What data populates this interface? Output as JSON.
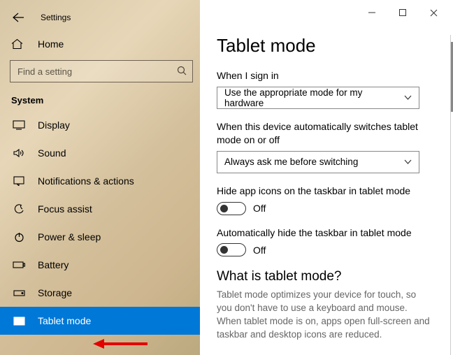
{
  "app_title": "Settings",
  "home_label": "Home",
  "search_placeholder": "Find a setting",
  "section_header": "System",
  "nav_items": [
    {
      "id": "display",
      "label": "Display"
    },
    {
      "id": "sound",
      "label": "Sound"
    },
    {
      "id": "notifications",
      "label": "Notifications & actions"
    },
    {
      "id": "focus-assist",
      "label": "Focus assist"
    },
    {
      "id": "power-sleep",
      "label": "Power & sleep"
    },
    {
      "id": "battery",
      "label": "Battery"
    },
    {
      "id": "storage",
      "label": "Storage"
    },
    {
      "id": "tablet-mode",
      "label": "Tablet mode",
      "selected": true
    }
  ],
  "page": {
    "title": "Tablet mode",
    "signin": {
      "label": "When I sign in",
      "value": "Use the appropriate mode for my hardware"
    },
    "auto_switch": {
      "label": "When this device automatically switches tablet mode on or off",
      "value": "Always ask me before switching"
    },
    "hide_icons": {
      "label": "Hide app icons on the taskbar in tablet mode",
      "state": "Off"
    },
    "auto_hide_taskbar": {
      "label": "Automatically hide the taskbar in tablet mode",
      "state": "Off"
    },
    "info_heading": "What is tablet mode?",
    "info_text": "Tablet mode optimizes your device for touch, so you don't have to use a keyboard and mouse. When tablet mode is on, apps open full-screen and taskbar and desktop icons are reduced."
  }
}
